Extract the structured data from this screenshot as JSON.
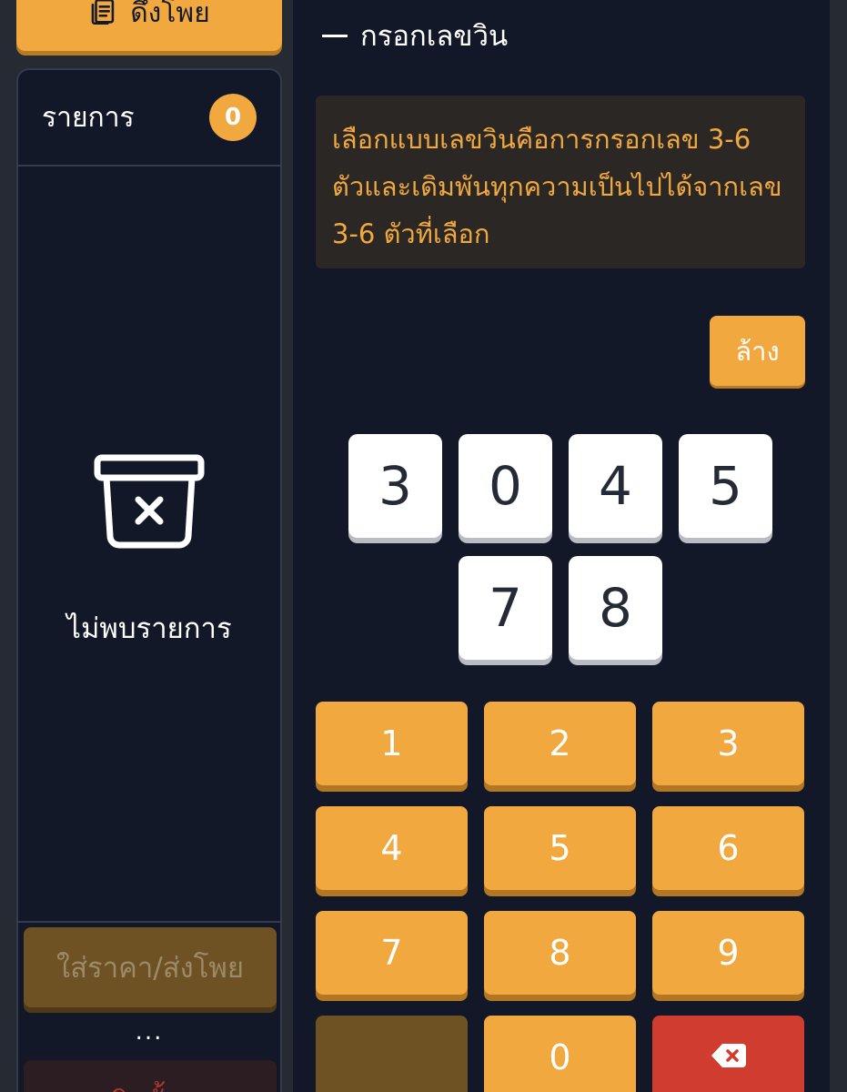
{
  "sidebar": {
    "top_button_label": "ดึงโพย",
    "list_title": "รายการ",
    "list_count": "0",
    "empty_text": "ไม่พบรายการ",
    "submit_label": "ใส่ราคา/ส่งโพย",
    "more": "...",
    "cancel_label": "ยกเลิกทั้งหมด"
  },
  "main": {
    "section_title": "กรอกเลขวิน",
    "info_text": "เลือกแบบเลขวินคือการกรอกเลข 3-6 ตัวและเดิมพันทุกความเป็นไปได้จากเลข 3-6 ตัวที่เลือก",
    "clear_label": "ล้าง",
    "selected_digits": [
      "3",
      "0",
      "4",
      "5",
      "7",
      "8"
    ],
    "keypad": [
      "1",
      "2",
      "3",
      "4",
      "5",
      "6",
      "7",
      "8",
      "9",
      "",
      "0"
    ]
  },
  "icons": {
    "top_button": "document-list-icon",
    "empty": "empty-box-x-icon",
    "backspace": "backspace-icon"
  },
  "colors": {
    "accent": "#f0a83f",
    "panel": "#121827",
    "danger": "#d03c2e",
    "disabled": "#6e5223"
  }
}
